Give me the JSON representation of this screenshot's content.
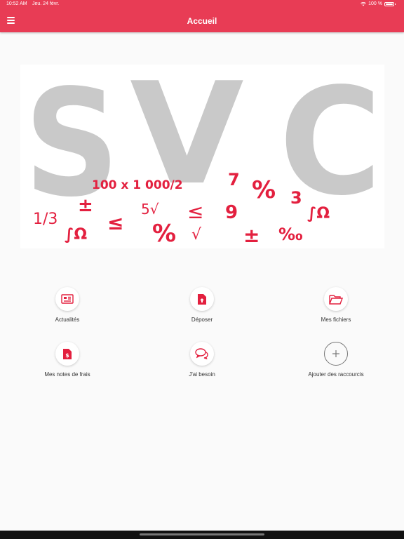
{
  "status_bar": {
    "time": "10:52 AM",
    "date": "Jeu. 24 févr.",
    "battery": "100 %"
  },
  "header": {
    "title": "Accueil"
  },
  "banner": {
    "letters": [
      "S",
      "V",
      "C"
    ],
    "symbols": [
      "100 x 1 000/2",
      "7",
      "%",
      "3",
      "1/3",
      "±",
      "5√",
      "≤",
      "9",
      "∫Ω",
      "∫Ω",
      "≤",
      "%",
      "√",
      "±",
      "‰"
    ]
  },
  "shortcuts": [
    {
      "label": "Actualités",
      "icon": "newspaper-icon"
    },
    {
      "label": "Déposer",
      "icon": "file-upload-icon"
    },
    {
      "label": "Mes fichiers",
      "icon": "folder-open-icon"
    },
    {
      "label": "Mes notes de frais",
      "icon": "expense-file-icon"
    },
    {
      "label": "J'ai besoin",
      "icon": "chat-bubbles-icon"
    },
    {
      "label": "Ajouter des raccourcis",
      "icon": "plus-icon"
    }
  ],
  "colors": {
    "brand": "#e83c55",
    "accent": "#e3203f"
  }
}
